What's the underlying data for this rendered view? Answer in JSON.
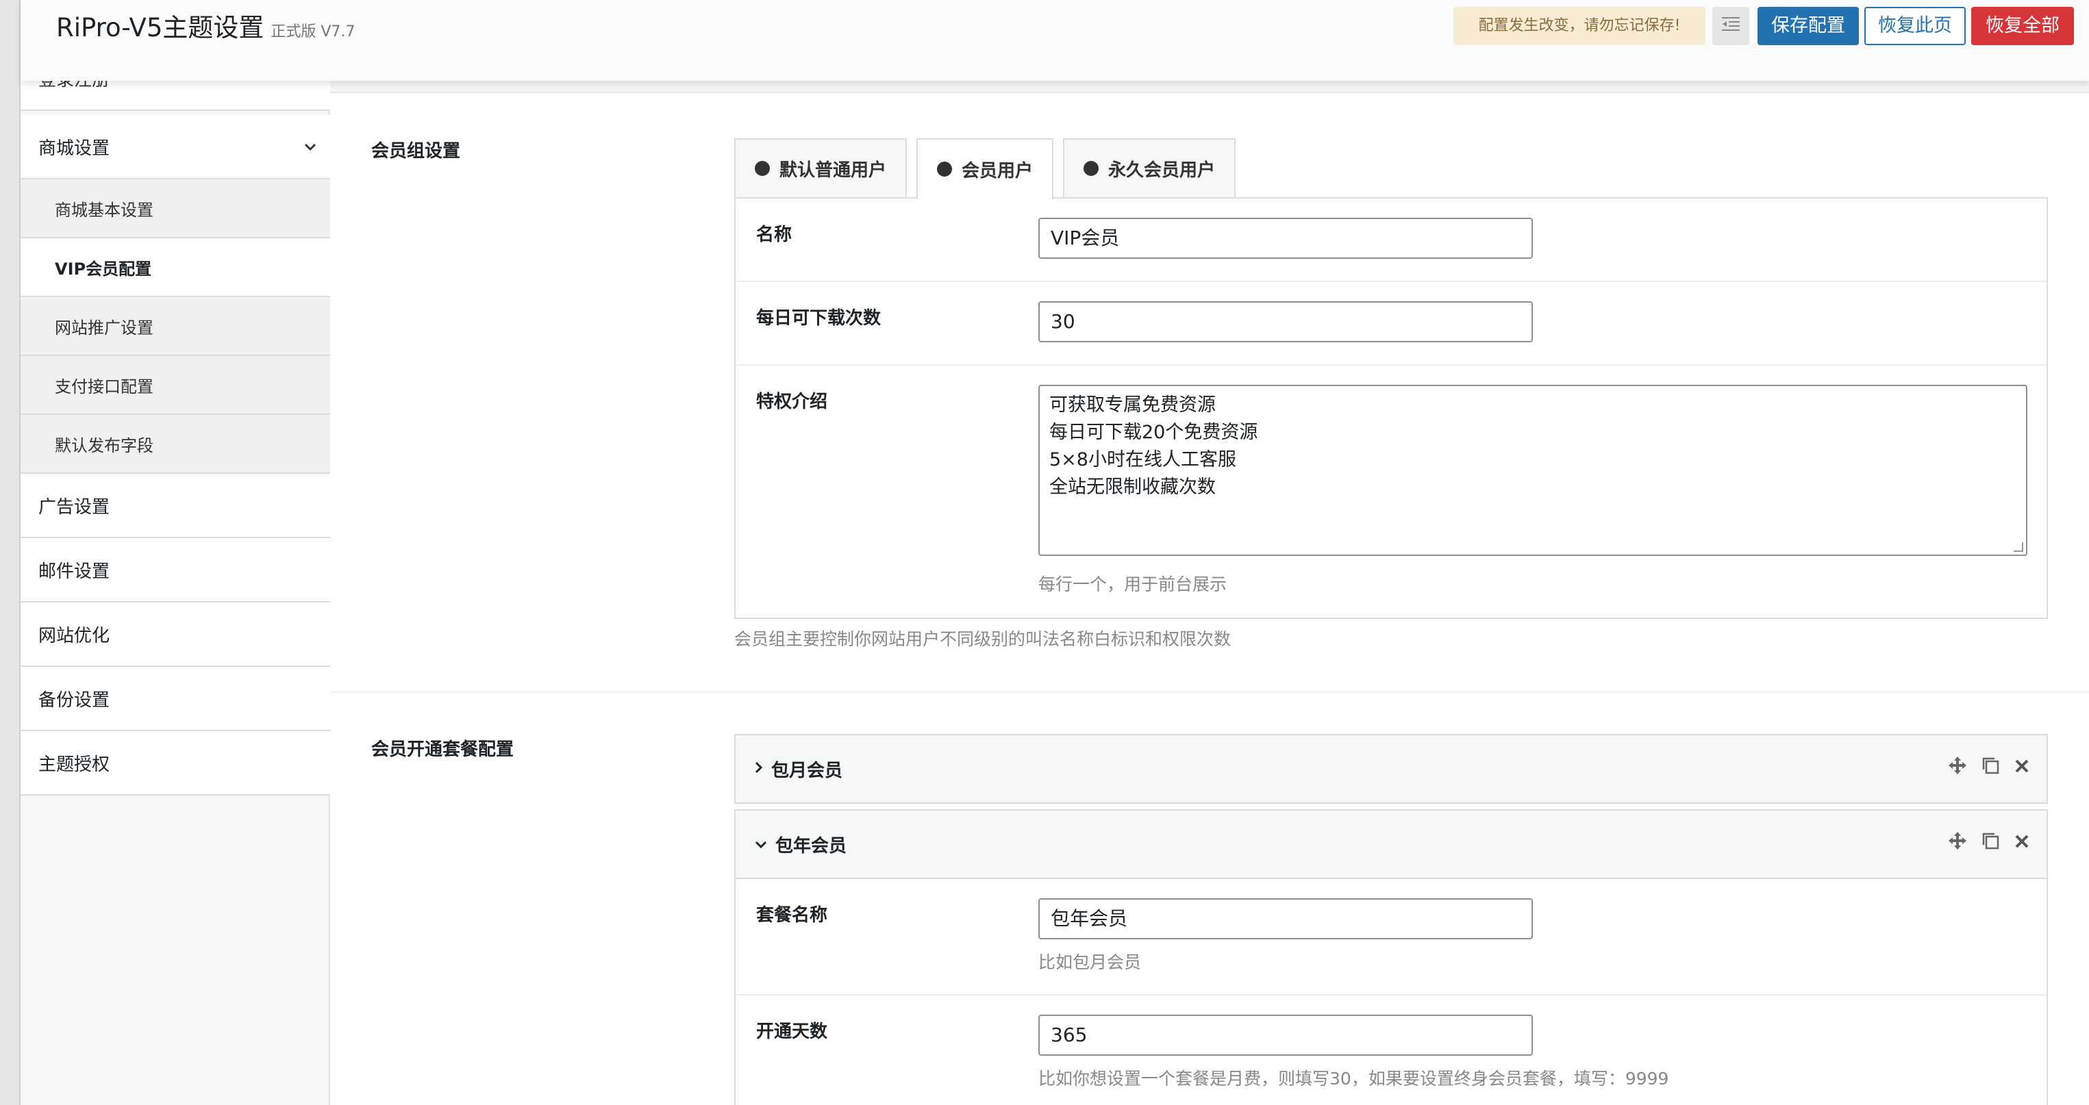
{
  "header": {
    "title": "RiPro-V5主题设置",
    "version": "正式版 V7.7",
    "notice": "配置发生改变，请勿忘记保存!",
    "save_label": "保存配置",
    "restore_page_label": "恢复此页",
    "restore_all_label": "恢复全部"
  },
  "sidebar": {
    "partial_item": "登录注册",
    "mall": "商城设置",
    "sub_items": [
      "商城基本设置",
      "VIP会员配置",
      "网站推广设置",
      "支付接口配置",
      "默认发布字段"
    ],
    "items": [
      "广告设置",
      "邮件设置",
      "网站优化",
      "备份设置",
      "主题授权"
    ]
  },
  "member_group": {
    "section_label": "会员组设置",
    "tabs": [
      "默认普通用户",
      "会员用户",
      "永久会员用户"
    ],
    "active_tab": "会员用户",
    "name_label": "名称",
    "name_value": "VIP会员",
    "downloads_label": "每日可下载次数",
    "downloads_value": "30",
    "privilege_label": "特权介绍",
    "privilege_lines": [
      "可获取专属免费资源",
      "每日可下载20个免费资源",
      "5×8小时在线人工客服",
      "全站无限制收藏次数"
    ],
    "privilege_help": "每行一个，用于前台展示",
    "section_help": "会员组主要控制你网站用户不同级别的叫法名称白标识和权限次数"
  },
  "packages": {
    "section_label": "会员开通套餐配置",
    "items": [
      {
        "title": "包月会员",
        "expanded": false
      },
      {
        "title": "包年会员",
        "expanded": true
      }
    ],
    "name_label": "套餐名称",
    "name_value": "包年会员",
    "name_help": "比如包月会员",
    "days_label": "开通天数",
    "days_value": "365",
    "days_help": "比如你想设置一个套餐是月费，则填写30，如果要设置终身会员套餐，填写：9999"
  }
}
